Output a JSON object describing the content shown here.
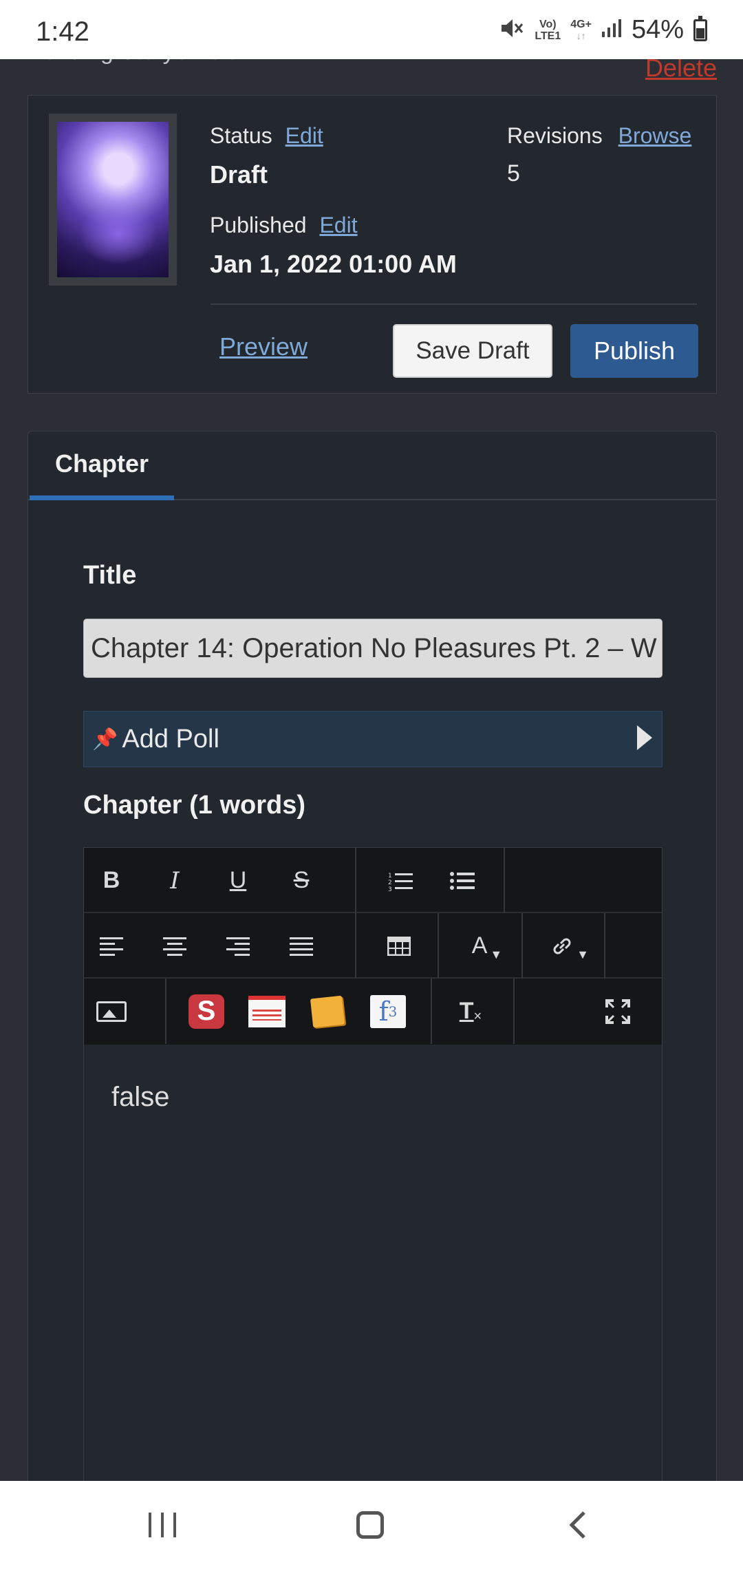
{
  "status_bar": {
    "time": "1:42",
    "network_top": "Vo)",
    "network_bottom": "LTE1",
    "network_type": "4G+",
    "battery": "54%"
  },
  "page": {
    "header": "Bending Story / Edit",
    "delete_label": "Delete"
  },
  "publish_panel": {
    "status_label": "Status",
    "status_edit": "Edit",
    "status_value": "Draft",
    "revisions_label": "Revisions",
    "revisions_browse": "Browse",
    "revisions_value": "5",
    "published_label": "Published",
    "published_edit": "Edit",
    "published_value": "Jan 1, 2022 01:00 AM",
    "preview_label": "Preview",
    "save_draft_label": "Save Draft",
    "publish_label": "Publish"
  },
  "chapter_panel": {
    "tab_label": "Chapter",
    "title_label": "Title",
    "title_value": "Chapter 14: Operation No Pleasures Pt. 2 – W",
    "add_poll_label": "Add Poll",
    "chapter_label": "Chapter (1 words)",
    "editor_content": "false"
  },
  "toolbar": {
    "bold": "B",
    "italic": "I",
    "underline": "U",
    "strike": "S",
    "font_color": "A",
    "clear_format": "T"
  },
  "icons": {
    "pin": "pin-icon",
    "poll_expand": "caret-right-icon",
    "fullscreen": "expand-icon"
  }
}
